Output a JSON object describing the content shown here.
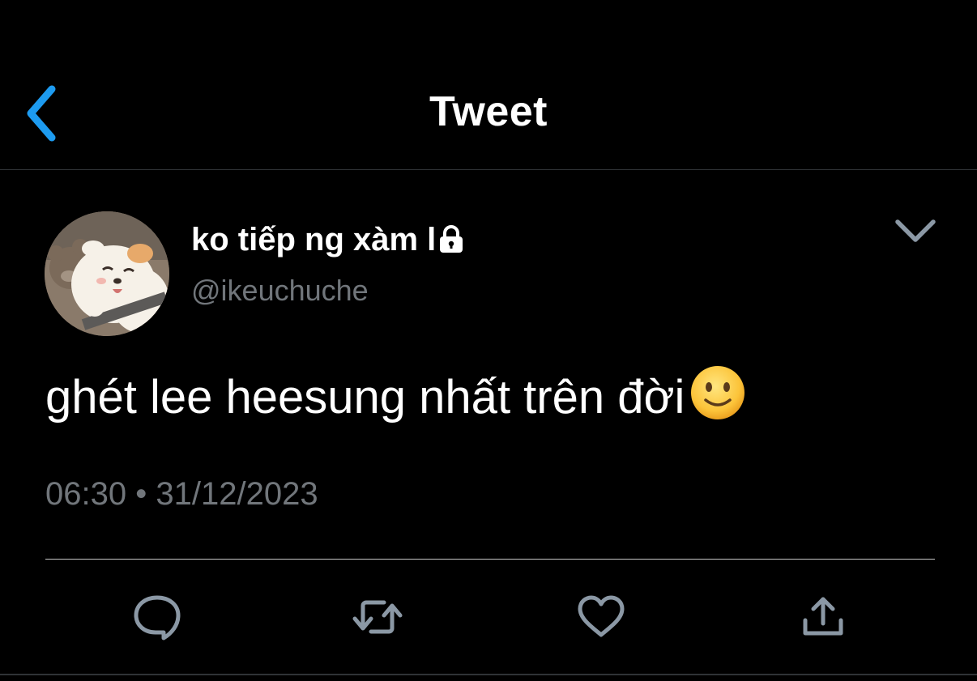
{
  "header": {
    "title": "Tweet",
    "back_icon": "chevron-left-icon",
    "accent_color": "#1d9bf0"
  },
  "tweet": {
    "author": {
      "display_name": "ko tiếp ng xàm l",
      "handle": "@ikeuchuche",
      "protected_icon": "lock-icon",
      "avatar": "avatar-illustration"
    },
    "more_icon": "chevron-down-icon",
    "text": "ghét lee heesung nhất trên đời",
    "text_emoji": "slightly-smiling-face-emoji",
    "time": "06:30",
    "separator": "•",
    "date": "31/12/2023"
  },
  "actions": [
    {
      "name": "reply",
      "icon": "reply-icon"
    },
    {
      "name": "retweet",
      "icon": "retweet-icon"
    },
    {
      "name": "like",
      "icon": "heart-icon"
    },
    {
      "name": "share",
      "icon": "share-icon"
    }
  ],
  "colors": {
    "background": "#000000",
    "text": "#ffffff",
    "muted": "#71767b",
    "icon": "#8b98a5"
  }
}
